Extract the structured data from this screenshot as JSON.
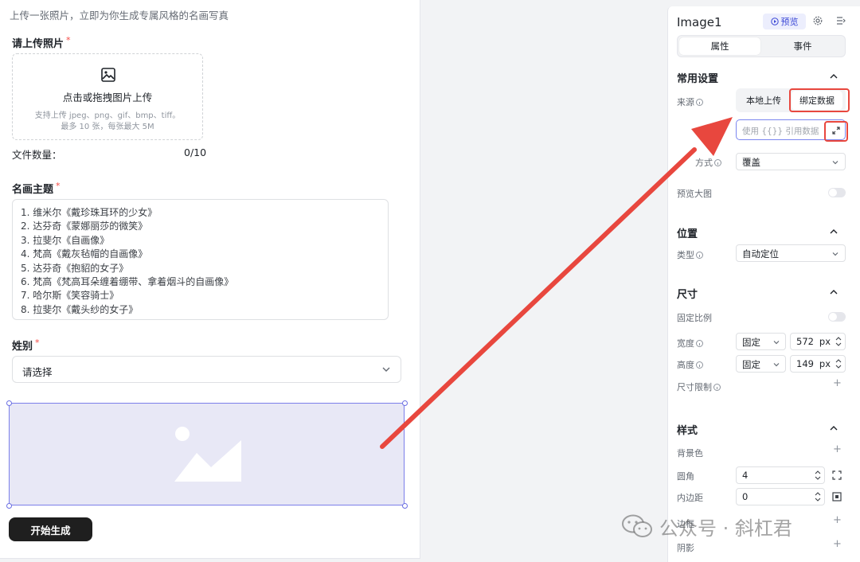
{
  "form": {
    "subtitle": "上传一张照片，立即为你生成专属风格的名画写真",
    "upload": {
      "label": "请上传照片",
      "required": "*",
      "title": "点击或拖拽图片上传",
      "hint1": "支持上传 jpeg、png、gif、bmp、tiff。",
      "hint2": "最多 10 张，每张最大 5M",
      "icon": "image-icon"
    },
    "file_count": {
      "label": "文件数量：",
      "value": "0/10"
    },
    "theme": {
      "label": "名画主题",
      "required": "*",
      "lines": [
        "1. 维米尔《戴珍珠耳环的少女》",
        "2. 达芬奇《蒙娜丽莎的微笑》",
        "3. 拉斐尔《自画像》",
        "4. 梵高《戴灰毡帽的自画像》",
        "5. 达芬奇《抱貂的女子》",
        "6. 梵高《梵高耳朵缠着绷带、拿着烟斗的自画像》",
        "7. 哈尔斯《笑容骑士》",
        "8. 拉斐尔《戴头纱的女子》"
      ]
    },
    "gender": {
      "label": "姓别",
      "required": "*",
      "placeholder": "请选择"
    },
    "start_button": "开始生成"
  },
  "panel": {
    "title": "Image1",
    "preview": "预览",
    "tabs": [
      {
        "label": "属性",
        "active": true
      },
      {
        "label": "事件",
        "active": false
      }
    ],
    "common": {
      "title": "常用设置",
      "source_label": "来源",
      "source_options": [
        "本地上传",
        "绑定数据"
      ],
      "source_selected": "绑定数据",
      "bind_placeholder": "使用 {{}} 引用数据",
      "fit_label": "方式",
      "fit_value": "覆盖",
      "preview_large_label": "预览大图"
    },
    "position": {
      "title": "位置",
      "type_label": "类型",
      "type_value": "自动定位"
    },
    "size": {
      "title": "尺寸",
      "fixed_ratio_label": "固定比例",
      "width_label": "宽度",
      "width_mode": "固定",
      "width_value": "572",
      "height_label": "高度",
      "height_mode": "固定",
      "height_value": "149",
      "unit": "px",
      "limit_label": "尺寸限制"
    },
    "style": {
      "title": "样式",
      "bg_label": "背景色",
      "radius_label": "圆角",
      "radius_value": "4",
      "padding_label": "内边距",
      "padding_value": "0",
      "border_label": "边框",
      "shadow_label": "阴影"
    }
  },
  "watermark": "公众号 · 斜杠君",
  "colors": {
    "accent": "#3a47d6",
    "annotation_red": "#e8473e",
    "selection": "#7b7fea",
    "image_fill": "#e8e8f6"
  }
}
